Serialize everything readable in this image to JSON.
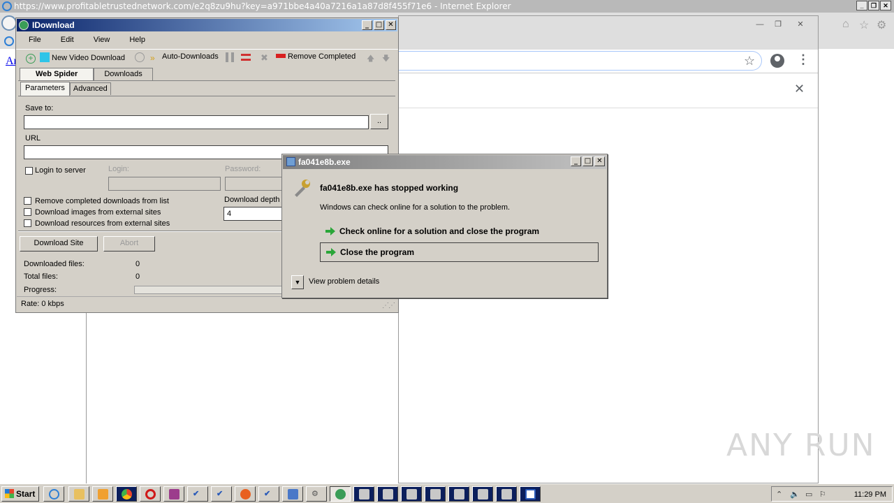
{
  "ie": {
    "title": "https://www.profitabletrustednetwork.com/e2q8zu9hu?key=a971bbe4a40a7216a1a87d8f455f71e6 - Internet Explorer",
    "partial_link": "Ar",
    "controls": [
      "_",
      "❐",
      "✕"
    ]
  },
  "chrome": {
    "controls": [
      "—",
      "❐",
      "✕"
    ],
    "bookmark_icon": "star-icon",
    "account_icon": "account-icon",
    "menu_icon": "more-vert-icon",
    "infobar_close": "✕"
  },
  "idownload": {
    "title": "IDownload",
    "controls": [
      "_",
      "□",
      "✕"
    ],
    "menu": [
      "File",
      "Edit",
      "View",
      "Help"
    ],
    "toolbar": {
      "new_video": "New Video Download",
      "auto_downloads": "Auto-Downloads",
      "remove_completed": "Remove Completed"
    },
    "tabs": [
      "Web Spider",
      "Downloads"
    ],
    "subtabs": [
      "Parameters",
      "Advanced"
    ],
    "save_to_label": "Save to:",
    "save_to_value": "",
    "browse_label": "..",
    "url_label": "URL",
    "url_value": "",
    "login_to_server": "Login to server",
    "login_label": "Login:",
    "password_label": "Password:",
    "remove_completed_check": "Remove completed downloads from list",
    "download_images_check": "Download images from external sites",
    "download_resources_check": "Download resources from external sites",
    "download_depth_label": "Download depth",
    "download_depth_value": "4",
    "download_site_btn": "Download Site",
    "abort_btn": "Abort",
    "downloaded_files_label": "Downloaded files:",
    "downloaded_files_value": "0",
    "total_files_label": "Total files:",
    "total_files_value": "0",
    "progress_label": "Progress:",
    "progress_value": 0,
    "rate": "Rate:  0 kbps"
  },
  "dialog": {
    "title": "fa041e8b.exe",
    "controls": [
      "_",
      "□",
      "✕"
    ],
    "main": "fa041e8b.exe has stopped working",
    "sub": "Windows can check online for a solution to the problem.",
    "option_check": "Check online for a solution and close the program",
    "option_close": "Close the program",
    "details": "View problem details"
  },
  "taskbar": {
    "start": "Start",
    "clock": "11:29 PM"
  },
  "watermark": "ANY RUN",
  "colors": {
    "idl_title_start": "#0a246a",
    "dialog_title": "#7f7f7f",
    "green_arrow": "#2aa639"
  }
}
